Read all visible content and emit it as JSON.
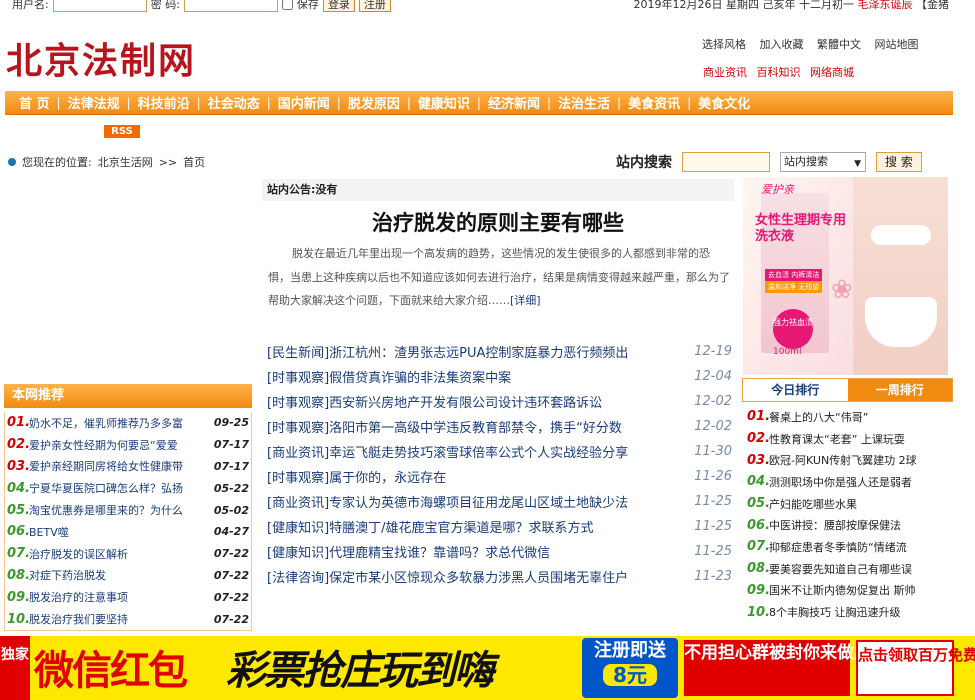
{
  "topbar": {
    "username_label": "用户名:",
    "password_label": "密  码:",
    "remember_label": "保存",
    "login_button": "登录",
    "register_button": "注册",
    "date_text": "2019年12月26日 星期四  己亥年 十二月初一 ",
    "holiday_text": "毛泽东诞辰",
    "tail_text": " 【金猪"
  },
  "header": {
    "logo": "北京法制网",
    "links": [
      "选择风格",
      "加入收藏",
      "繁體中文",
      "网站地图"
    ],
    "links2": [
      "商业资讯",
      "百科知识",
      "网络商城"
    ]
  },
  "nav": [
    "首 页",
    "法律法规",
    "科技前沿",
    "社会动态",
    "国内新闻",
    "脱发原因",
    "健康知识",
    "经济新闻",
    "法治生活",
    "美食资讯",
    "美食文化"
  ],
  "rss_label": "RSS",
  "breadcrumb": {
    "prefix": "您现在的位置:",
    "site": "北京生活网",
    "sep": ">>",
    "current": "首页"
  },
  "search": {
    "label": "站内搜索",
    "select_value": "站内搜索",
    "button": "搜 索"
  },
  "notice": "站内公告:没有",
  "article": {
    "title": "治疗脱发的原则主要有哪些",
    "summary": "脱发在最近几年里出现一个高发病的趋势，这些情况的发生使很多的人都感到非常的恐惧，当患上这种疾病以后也不知道应该如何去进行治疗，结果是病情变得越来越严重，那么为了帮助大家解决这个问题，下面就来给大家介绍……",
    "more": "[详细]"
  },
  "news": [
    {
      "title": "[民生新闻]浙江杭州：渣男张志远PUA控制家庭暴力恶行频频出",
      "date": "12-19"
    },
    {
      "title": "[时事观察]假借贷真诈骗的非法集资案中案",
      "date": "12-04"
    },
    {
      "title": "[时事观察]西安新兴房地产开发有限公司设计违环套路诉讼",
      "date": "12-02"
    },
    {
      "title": "[时事观察]洛阳市第一高级中学违反教育部禁令，携手“好分数",
      "date": "12-02"
    },
    {
      "title": "[商业资讯]幸运飞艇走势技巧滚雪球倍率公式个人实战经验分享",
      "date": "11-30"
    },
    {
      "title": "[时事观察]属于你的，永远存在",
      "date": "11-26"
    },
    {
      "title": "[商业资讯]专家认为英德市海螺项目征用龙尾山区域土地缺少法",
      "date": "11-25"
    },
    {
      "title": "[健康知识]特膳澳丁/雄花鹿宝官方渠道是哪？求联系方式",
      "date": "11-25"
    },
    {
      "title": "[健康知识]代理鹿精宝找谁？靠谱吗？求总代微信",
      "date": "11-25"
    },
    {
      "title": "[法律咨询]保定市某小区惊现众多软暴力涉黑人员围堵无辜住户",
      "date": "11-23"
    }
  ],
  "ad": {
    "brand": "爱护亲",
    "headline": "女性生理期专用洗衣液",
    "pill1": "去血渍 内裤清洁",
    "pill2": "温和洁净 无残留",
    "badge": "强力祛血渍",
    "volume": "100ml"
  },
  "rank": {
    "tab_today": "今日排行",
    "tab_week": "一周排行",
    "items": [
      {
        "n": "01.",
        "t": "餐桌上的八大“伟哥”"
      },
      {
        "n": "02.",
        "t": "性教育课太“老套” 上课玩耍"
      },
      {
        "n": "03.",
        "t": "欧冠-阿KUN传射飞翼建功 2球"
      },
      {
        "n": "04.",
        "t": "测测职场中你是强人还是弱者"
      },
      {
        "n": "05.",
        "t": "产妇能吃哪些水果"
      },
      {
        "n": "06.",
        "t": "中医讲授：腰部按摩保健法"
      },
      {
        "n": "07.",
        "t": "抑郁症患者冬季慎防“情绪流"
      },
      {
        "n": "08.",
        "t": "要美容要先知道自己有哪些误"
      },
      {
        "n": "09.",
        "t": "国米不让斯内德匆促复出 斯帅"
      },
      {
        "n": "10.",
        "t": "8个丰胸技巧 让胸迅速升级"
      }
    ]
  },
  "recommend": {
    "title": "本网推荐",
    "items": [
      {
        "n": "01.",
        "t": "奶水不足，催乳师推荐乃多多富",
        "d": "09-25"
      },
      {
        "n": "02.",
        "t": "爱护亲女性经期为何要忌“爱爱",
        "d": "07-17"
      },
      {
        "n": "03.",
        "t": "爱护亲经期同房将给女性健康带",
        "d": "07-17"
      },
      {
        "n": "04.",
        "t": "宁夏华夏医院口碑怎么样？弘扬",
        "d": "05-22"
      },
      {
        "n": "05.",
        "t": "淘宝优惠券是哪里来的？为什么",
        "d": "05-02"
      },
      {
        "n": "06.",
        "t": "BETV噬",
        "d": "04-27"
      },
      {
        "n": "07.",
        "t": "治疗脱发的误区解析",
        "d": "07-22"
      },
      {
        "n": "08.",
        "t": "对症下药治脱发",
        "d": "07-22"
      },
      {
        "n": "09.",
        "t": "脱发治疗的注意事项",
        "d": "07-22"
      },
      {
        "n": "10.",
        "t": "脱发治疗我们要坚持",
        "d": "07-22"
      }
    ]
  },
  "banner": {
    "b1": "独家",
    "b2": "微信红包",
    "b3": "彩票抢庄玩到嗨",
    "b4a": "注册即送",
    "b4b": "8元",
    "b5": "不用担心群被封你来做庄做老板",
    "b6": "点击领取百万免费红包"
  },
  "colors": {
    "accent_orange": "#f08a10",
    "brand_red": "#b8141b",
    "link_blue": "#1a3c7a"
  }
}
